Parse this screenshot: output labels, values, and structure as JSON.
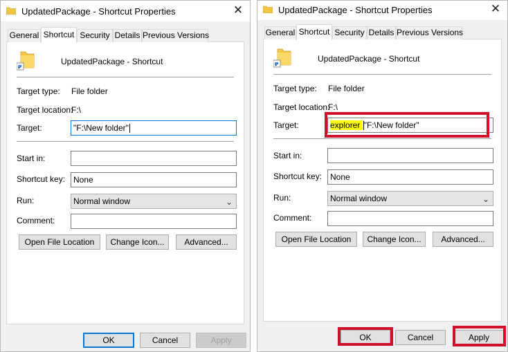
{
  "dialogs": [
    {
      "title": "UpdatedPackage - Shortcut Properties",
      "close_glyph": "✕",
      "tabs": [
        "General",
        "Shortcut",
        "Security",
        "Details",
        "Previous Versions"
      ],
      "active_tab": "Shortcut",
      "shortcut_name": "UpdatedPackage - Shortcut",
      "target_type_label": "Target type:",
      "target_type_value": "File folder",
      "target_location_label": "Target location:",
      "target_location_value": "F:\\",
      "target_label": "Target:",
      "target_value": "\"F:\\New folder\"",
      "start_in_label": "Start in:",
      "start_in_value": "",
      "shortcut_key_label": "Shortcut key:",
      "shortcut_key_value": "None",
      "run_label": "Run:",
      "run_value": "Normal window",
      "comment_label": "Comment:",
      "comment_value": "",
      "open_file_location_label": "Open File Location",
      "change_icon_label": "Change Icon...",
      "advanced_label": "Advanced...",
      "ok_label": "OK",
      "cancel_label": "Cancel",
      "apply_label": "Apply",
      "apply_enabled": false
    },
    {
      "title": "UpdatedPackage - Shortcut Properties",
      "close_glyph": "✕",
      "tabs": [
        "General",
        "Shortcut",
        "Security",
        "Details",
        "Previous Versions"
      ],
      "active_tab": "Shortcut",
      "shortcut_name": "UpdatedPackage - Shortcut",
      "target_type_label": "Target type:",
      "target_type_value": "File folder",
      "target_location_label": "Target location:",
      "target_location_value": "F:\\",
      "target_label": "Target:",
      "target_value_highlighted": "explorer ",
      "target_value_rest": "\"F:\\New folder\"",
      "start_in_label": "Start in:",
      "start_in_value": "",
      "shortcut_key_label": "Shortcut key:",
      "shortcut_key_value": "None",
      "run_label": "Run:",
      "run_value": "Normal window",
      "comment_label": "Comment:",
      "comment_value": "",
      "open_file_location_label": "Open File Location",
      "change_icon_label": "Change Icon...",
      "advanced_label": "Advanced...",
      "ok_label": "OK",
      "cancel_label": "Cancel",
      "apply_label": "Apply",
      "apply_enabled": true
    }
  ],
  "colors": {
    "annotation_red": "#d0102a",
    "text_highlight": "#ffff00",
    "focus_blue": "#0078d7",
    "folder_yellow": "#f3c544"
  },
  "icons": {
    "folder": "folder-icon",
    "shortcut_arrow": "shortcut-arrow-icon",
    "close": "close-icon",
    "dropdown": "chevron-down-icon"
  }
}
